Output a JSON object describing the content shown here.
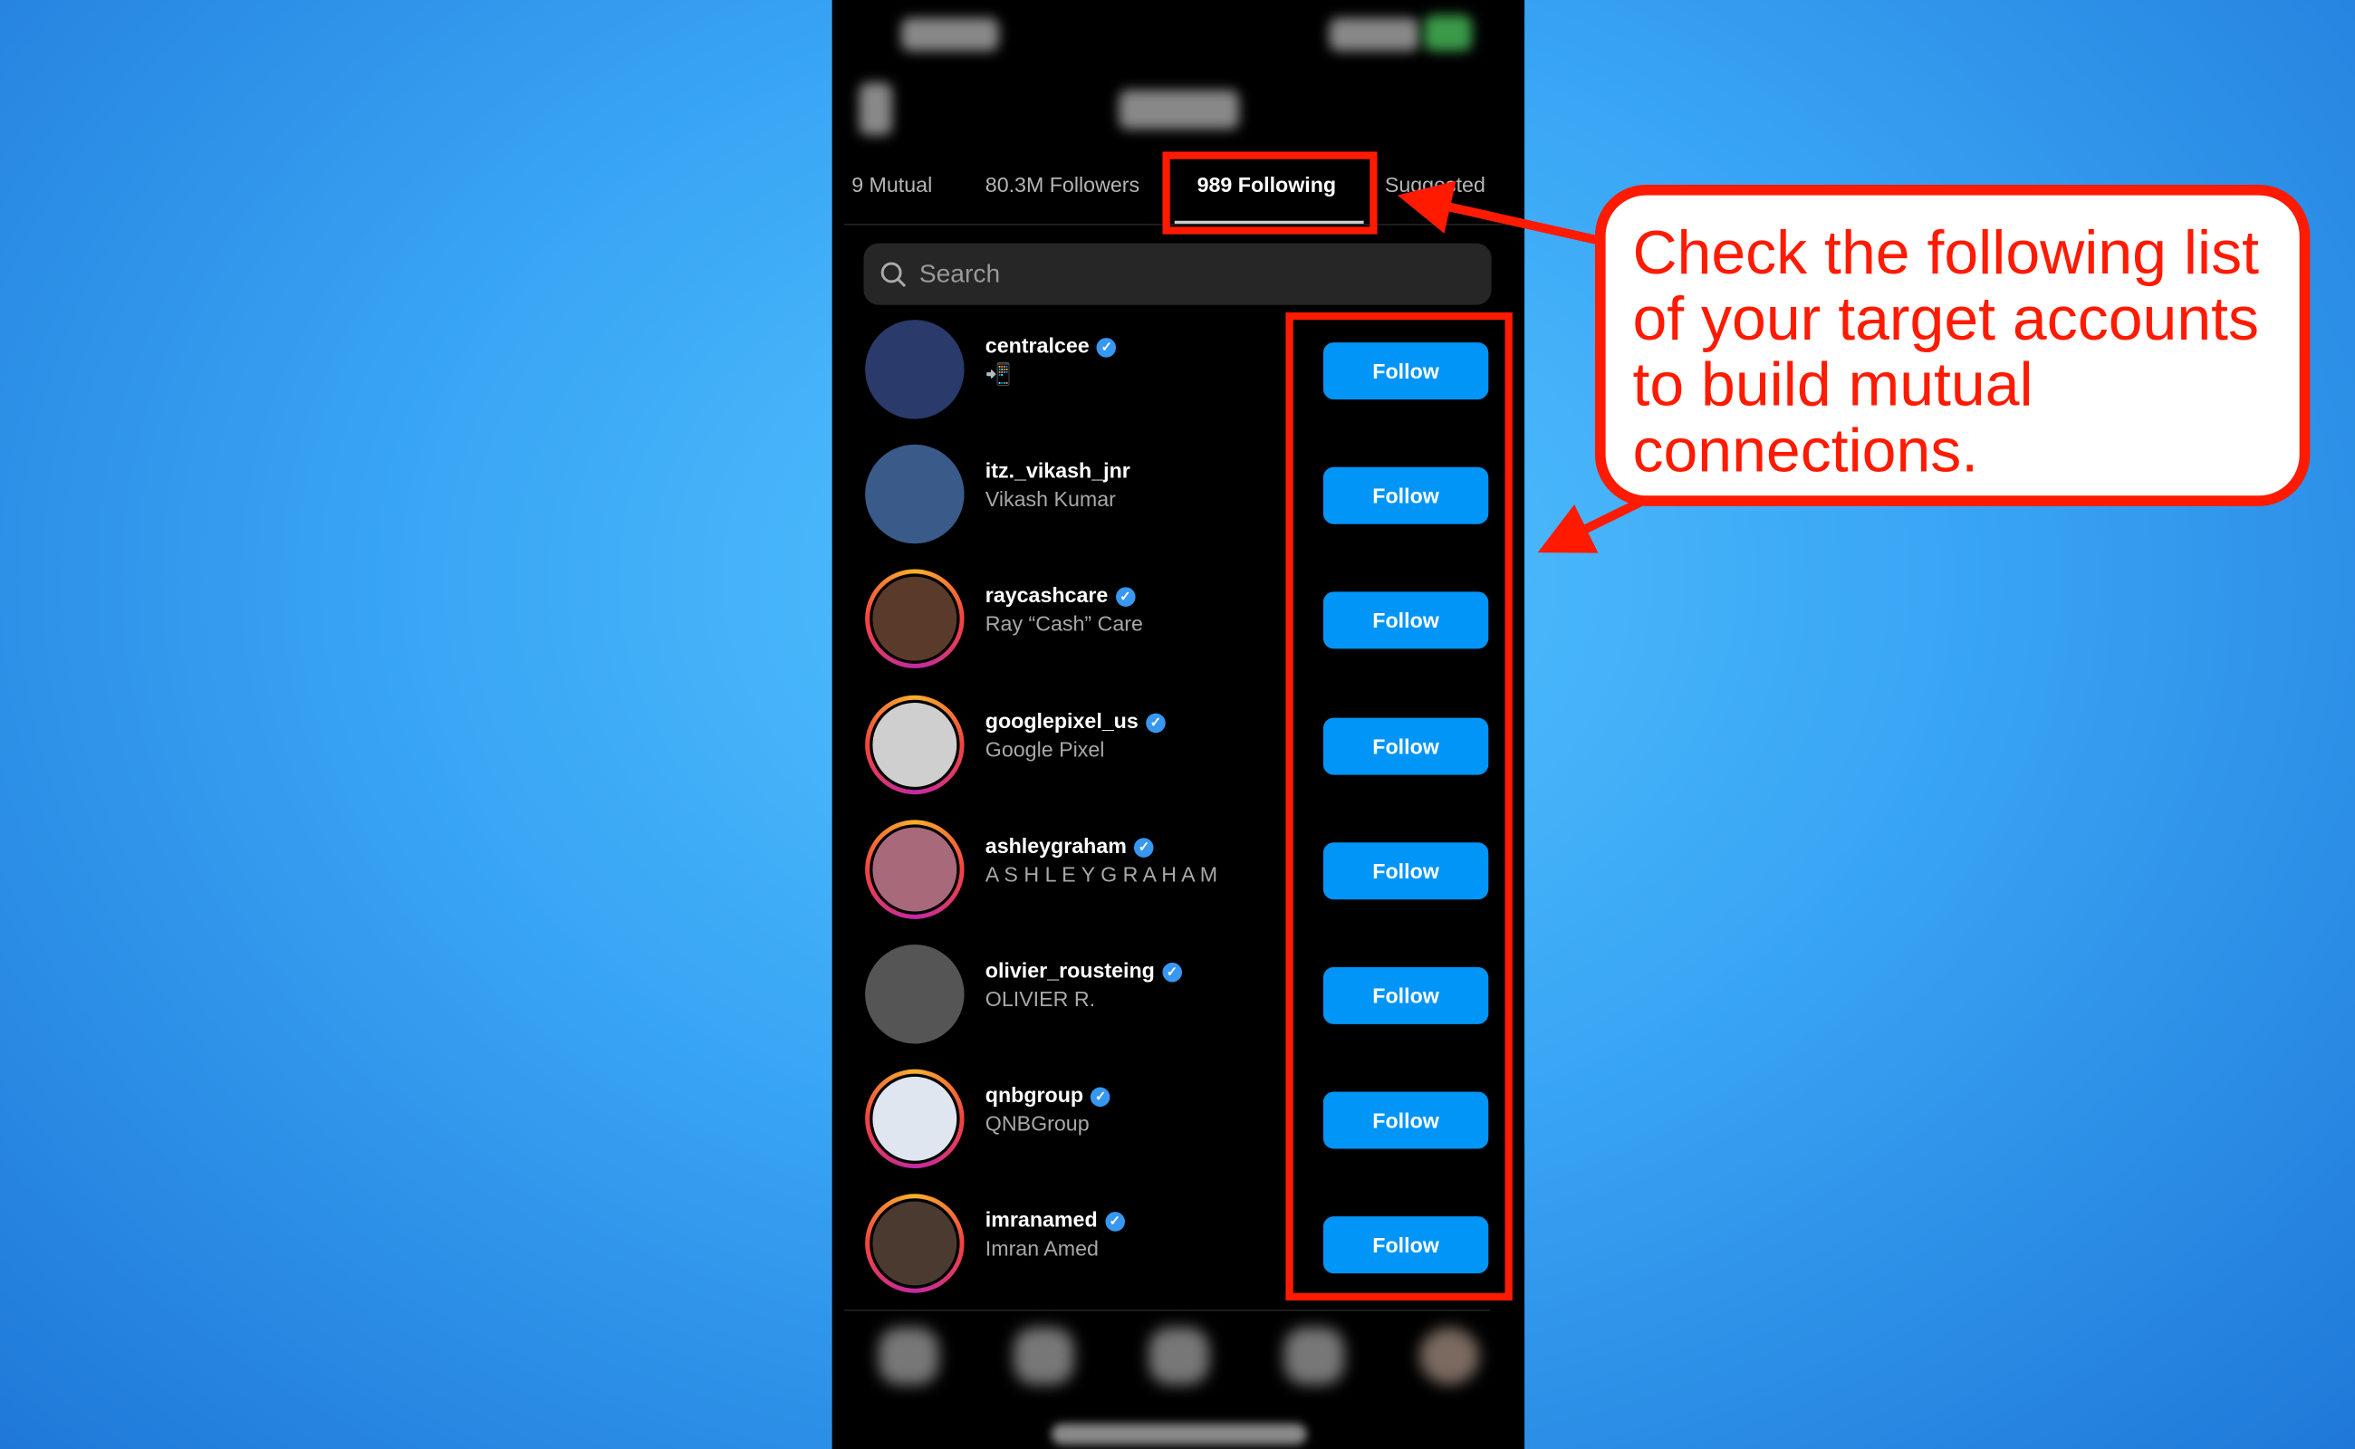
{
  "tabs": [
    {
      "label": "9 Mutual"
    },
    {
      "label": "80.3M Followers"
    },
    {
      "label": "989 Following",
      "active": true
    },
    {
      "label": "Suggested"
    }
  ],
  "search": {
    "placeholder": "Search",
    "icon": "search-icon"
  },
  "accounts": [
    {
      "username": "centralcee",
      "name": "📲",
      "verified": true,
      "story_ring": false,
      "button": "Follow"
    },
    {
      "username": "itz._vikash_jnr",
      "name": "Vikash Kumar",
      "verified": false,
      "story_ring": false,
      "button": "Follow"
    },
    {
      "username": "raycashcare",
      "name": "Ray “Cash” Care",
      "verified": true,
      "story_ring": true,
      "button": "Follow"
    },
    {
      "username": "googlepixel_us",
      "name": "Google Pixel",
      "verified": true,
      "story_ring": true,
      "button": "Follow"
    },
    {
      "username": "ashleygraham",
      "name": "A S H L E Y  G R A H A M",
      "verified": true,
      "story_ring": true,
      "button": "Follow"
    },
    {
      "username": "olivier_rousteing",
      "name": "OLIVIER R.",
      "verified": true,
      "story_ring": false,
      "button": "Follow"
    },
    {
      "username": "qnbgroup",
      "name": "QNBGroup",
      "verified": true,
      "story_ring": true,
      "button": "Follow"
    },
    {
      "username": "imranamed",
      "name": "Imran Amed",
      "verified": true,
      "story_ring": true,
      "button": "Follow"
    }
  ],
  "callout": {
    "text": "Check the following list of your target accounts to build mutual connections."
  },
  "colors": {
    "follow_button": "#0095f6",
    "annotation_red": "#ff1a00",
    "verified": "#3897f0"
  }
}
